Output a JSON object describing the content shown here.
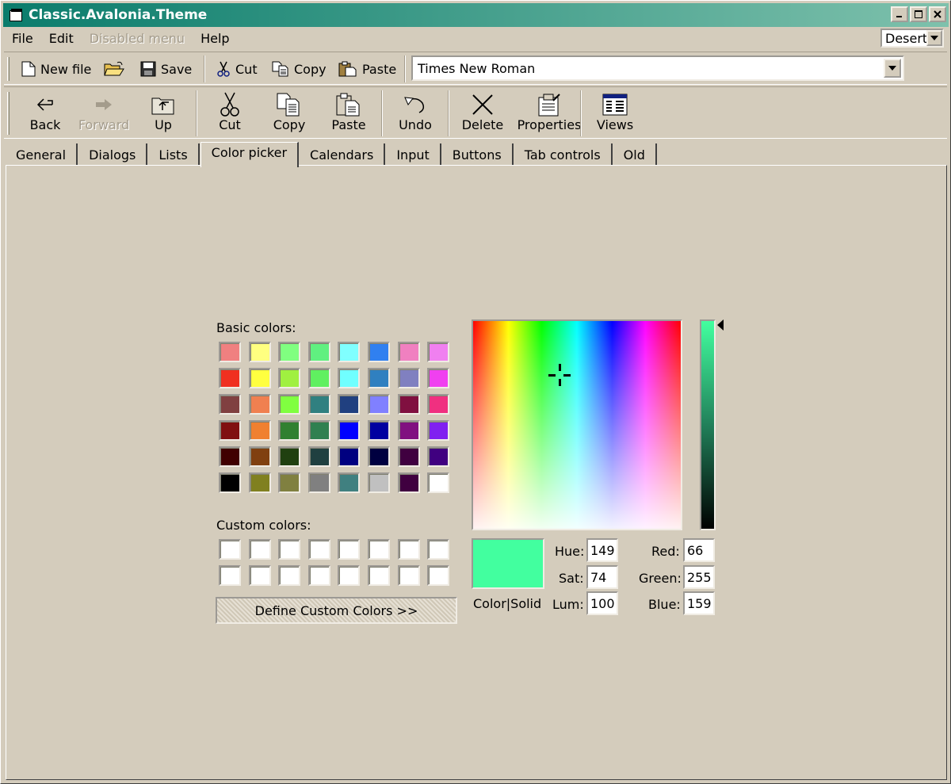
{
  "window": {
    "title": "Classic.Avalonia.Theme",
    "controls": [
      "minimize",
      "maximize",
      "close"
    ]
  },
  "menu": {
    "items": [
      "File",
      "Edit",
      "Disabled menu",
      "Help"
    ],
    "theme_selected": "Desert"
  },
  "toolbar1": {
    "new_file": "New file",
    "save": "Save",
    "cut": "Cut",
    "copy": "Copy",
    "paste": "Paste",
    "font_selected": "Times New Roman"
  },
  "toolbar2": {
    "back": "Back",
    "forward": "Forward",
    "up": "Up",
    "cut": "Cut",
    "copy": "Copy",
    "paste": "Paste",
    "undo": "Undo",
    "delete": "Delete",
    "properties": "Properties",
    "views": "Views"
  },
  "tabs": [
    "General",
    "Dialogs",
    "Lists",
    "Color picker",
    "Calendars",
    "Input",
    "Buttons",
    "Tab controls",
    "Old"
  ],
  "active_tab": "Color picker",
  "color_picker": {
    "basic_colors_label": "Basic colors:",
    "basic_colors": [
      [
        "#f08080",
        "#ffff80",
        "#80ff80",
        "#60f080",
        "#80ffff",
        "#3080f0",
        "#f080c0",
        "#f080f0"
      ],
      [
        "#f03020",
        "#ffff40",
        "#a0f040",
        "#60f060",
        "#70ffff",
        "#3080c0",
        "#8080c0",
        "#f040f0"
      ],
      [
        "#804040",
        "#f08050",
        "#80ff40",
        "#308080",
        "#204080",
        "#8080ff",
        "#801040",
        "#f03080"
      ],
      [
        "#801010",
        "#f08030",
        "#308030",
        "#308050",
        "#0000ff",
        "#0000a0",
        "#801080",
        "#8020f0"
      ],
      [
        "#400000",
        "#804010",
        "#204010",
        "#204040",
        "#000080",
        "#000040",
        "#400040",
        "#400080"
      ],
      [
        "#000000",
        "#808020",
        "#808040",
        "#808080",
        "#408080",
        "#c0c0c0",
        "#400040",
        "#ffffff"
      ]
    ],
    "custom_colors_label": "Custom colors:",
    "custom_colors": [
      [
        "#ffffff",
        "#ffffff",
        "#ffffff",
        "#ffffff",
        "#ffffff",
        "#ffffff",
        "#ffffff",
        "#ffffff"
      ],
      [
        "#ffffff",
        "#ffffff",
        "#ffffff",
        "#ffffff",
        "#ffffff",
        "#ffffff",
        "#ffffff",
        "#ffffff"
      ]
    ],
    "define_button": "Define Custom Colors >>",
    "preview_label": "Color|Solid",
    "preview_color": "#42ff9f",
    "hue_label": "Hue:",
    "hue": "149",
    "sat_label": "Sat:",
    "sat": "74",
    "lum_label": "Lum:",
    "lum": "100",
    "red_label": "Red:",
    "red": "66",
    "green_label": "Green:",
    "green": "255",
    "blue_label": "Blue:",
    "blue": "159"
  },
  "colors": {
    "title_start": "#0a7c6c",
    "title_end": "#7ec1ac",
    "face": "#d4ccbc"
  }
}
